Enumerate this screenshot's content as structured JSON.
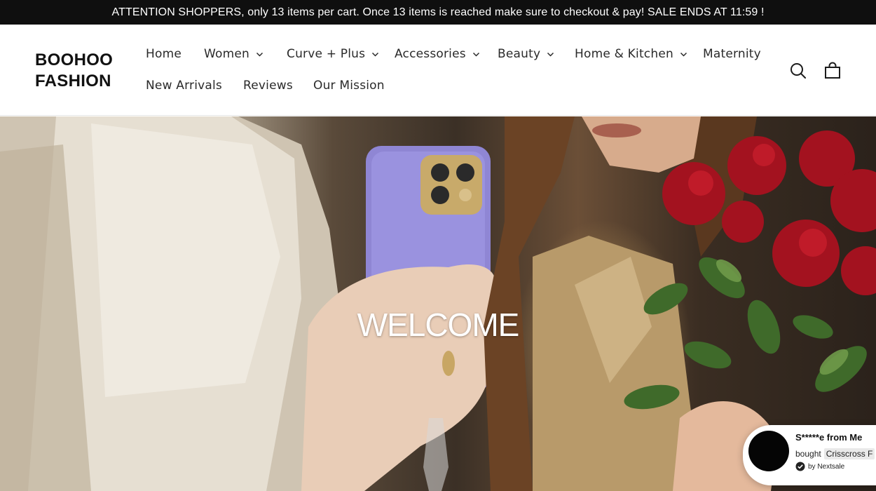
{
  "announcement": {
    "text": "ATTENTION SHOPPERS, only 13 items per cart. Once 13 items is reached make sure to checkout & pay! SALE ENDS AT 11:59 !"
  },
  "header": {
    "logo_line1": "BOOHOO",
    "logo_line2": "FASHION",
    "nav": [
      {
        "label": "Home",
        "has_dropdown": false
      },
      {
        "label": "Women",
        "has_dropdown": true
      },
      {
        "label": "Curve + Plus",
        "has_dropdown": true
      },
      {
        "label": "Accessories",
        "has_dropdown": true
      },
      {
        "label": "Beauty",
        "has_dropdown": true
      },
      {
        "label": "Home & Kitchen",
        "has_dropdown": true
      },
      {
        "label": "Maternity",
        "has_dropdown": false
      },
      {
        "label": "New Arrivals",
        "has_dropdown": false
      },
      {
        "label": "Reviews",
        "has_dropdown": false
      },
      {
        "label": "Our Mission",
        "has_dropdown": false
      }
    ],
    "icons": {
      "search": "search-icon",
      "cart": "cart-icon",
      "dropdown": "chevron-down-icon"
    }
  },
  "hero": {
    "heading": "WELCOME"
  },
  "toast": {
    "title": "S*****e from Me",
    "bought_label": "bought",
    "product": "Crisscross F",
    "badge": "by Nextsale"
  },
  "colors": {
    "announcement_bg": "#0f0f0f",
    "text_dark": "#1c1c1c",
    "hero_text": "#ffffff"
  }
}
